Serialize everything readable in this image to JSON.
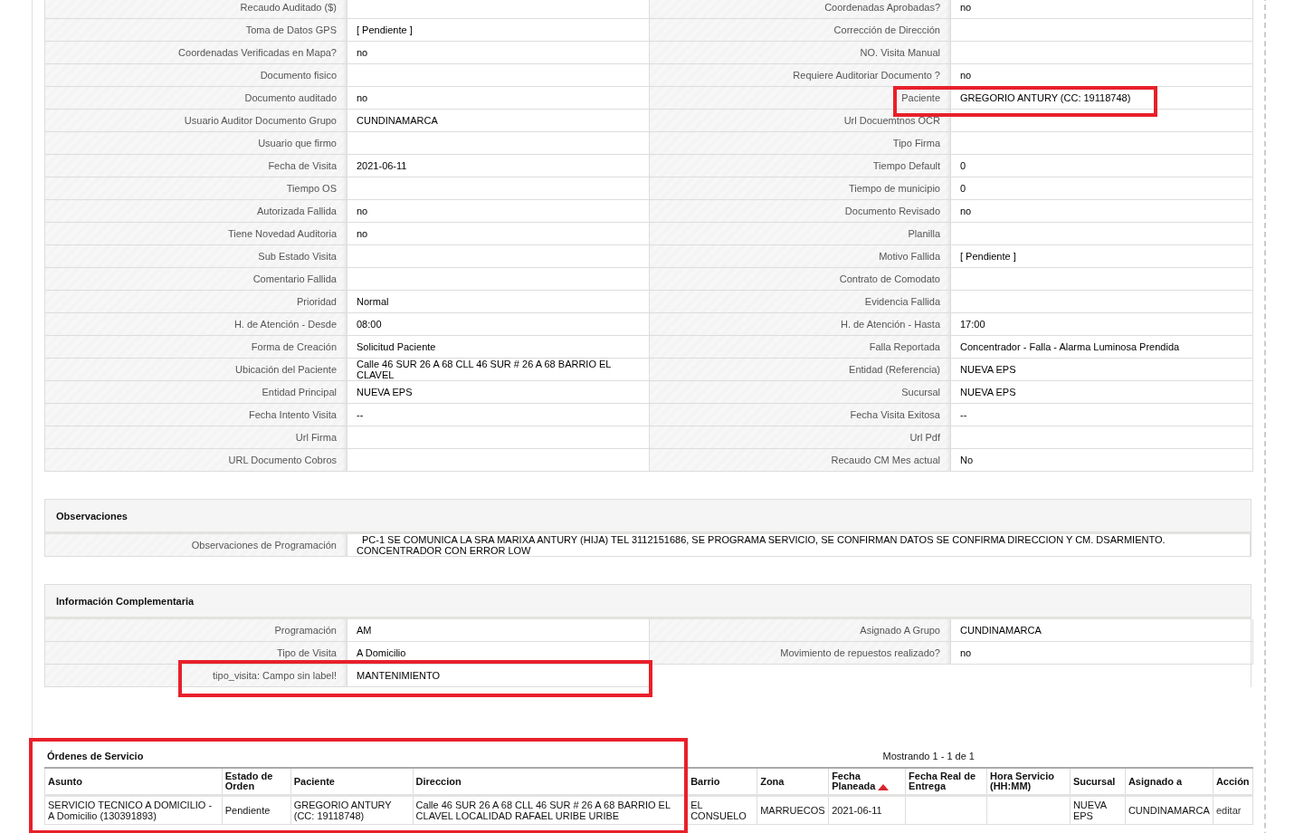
{
  "details": {
    "rows": [
      {
        "left": {
          "label": "Recaudo Auditado ($)"
        },
        "right": {
          "label": "Coordenadas Aprobadas?",
          "value": "no",
          "highlighted": false
        }
      },
      {
        "left": {
          "label": "Toma de Datos GPS",
          "value": "[ Pendiente ]"
        },
        "right": {
          "label": "Corrección de Dirección",
          "highlighted": false
        }
      },
      {
        "left": {
          "label": "Coordenadas Verificadas en Mapa?",
          "value": "no"
        },
        "right": {
          "label": "NO. Visita Manual",
          "highlighted": false
        }
      },
      {
        "left": {
          "label": "Documento fisico"
        },
        "right": {
          "label": "Requiere Auditoriar Documento ?",
          "value": "no",
          "highlighted": false
        }
      },
      {
        "left": {
          "label": "Documento auditado",
          "value": "no"
        },
        "right": {
          "label": "Paciente",
          "value": "GREGORIO ANTURY (CC: 19118748)",
          "highlighted": true
        }
      },
      {
        "left": {
          "label": "Usuario Auditor Documento Grupo",
          "value": "CUNDINAMARCA"
        },
        "right": {
          "label": "Url Docuemtnos OCR",
          "highlighted": false
        }
      },
      {
        "left": {
          "label": "Usuario que firmo"
        },
        "right": {
          "label": "Tipo Firma",
          "highlighted": false
        }
      },
      {
        "left": {
          "label": "Fecha de Visita",
          "value": "2021-06-11"
        },
        "right": {
          "label": "Tiempo Default",
          "value": "0",
          "highlighted": false
        }
      },
      {
        "left": {
          "label": "Tiempo OS"
        },
        "right": {
          "label": "Tiempo de municipio",
          "value": "0",
          "highlighted": false
        }
      },
      {
        "left": {
          "label": "Autorizada Fallida",
          "value": "no"
        },
        "right": {
          "label": "Documento Revisado",
          "value": "no",
          "highlighted": false
        }
      },
      {
        "left": {
          "label": "Tiene Novedad Auditoria",
          "value": "no"
        },
        "right": {
          "label": "Planilla",
          "highlighted": false
        }
      },
      {
        "left": {
          "label": "Sub Estado Visita"
        },
        "right": {
          "label": "Motivo Fallida",
          "value": "[ Pendiente ]",
          "highlighted": false
        }
      },
      {
        "left": {
          "label": "Comentario Fallida"
        },
        "right": {
          "label": "Contrato de Comodato",
          "highlighted": false
        }
      },
      {
        "left": {
          "label": "Prioridad",
          "value": "Normal"
        },
        "right": {
          "label": "Evidencia Fallida",
          "highlighted": false
        }
      },
      {
        "left": {
          "label": "H. de Atención - Desde",
          "value": "08:00"
        },
        "right": {
          "label": "H. de Atención - Hasta",
          "value": "17:00",
          "highlighted": false
        }
      },
      {
        "left": {
          "label": "Forma de Creación",
          "value": "Solicitud Paciente"
        },
        "right": {
          "label": "Falla Reportada",
          "value": "Concentrador - Falla - Alarma Luminosa Prendida",
          "highlighted": false
        }
      },
      {
        "left": {
          "label": "Ubicación del Paciente",
          "value": "Calle 46 SUR 26 A 68 CLL 46 SUR # 26 A 68 BARRIO EL CLAVEL"
        },
        "right": {
          "label": "Entidad (Referencia)",
          "value": "NUEVA EPS",
          "highlighted": false
        }
      },
      {
        "left": {
          "label": "Entidad Principal",
          "value": "NUEVA EPS"
        },
        "right": {
          "label": "Sucursal",
          "value": "NUEVA EPS",
          "highlighted": false
        }
      },
      {
        "left": {
          "label": "Fecha Intento Visita",
          "value": "--"
        },
        "right": {
          "label": "Fecha Visita Exitosa",
          "value": "--",
          "highlighted": false
        }
      },
      {
        "left": {
          "label": "Url Firma"
        },
        "right": {
          "label": "Url Pdf",
          "highlighted": false
        }
      },
      {
        "left": {
          "label": "URL Documento Cobros"
        },
        "right": {
          "label": "Recaudo CM Mes actual",
          "value": "No",
          "highlighted": false
        }
      }
    ]
  },
  "observaciones": {
    "title": "Observaciones",
    "label": "Observaciones de Programación",
    "value": "PC-1 SE COMUNICA LA SRA MARIXA ANTURY (HIJA) TEL 3112151686, SE PROGRAMA SERVICIO, SE CONFIRMAN DATOS SE CONFIRMA DIRECCION Y CM. DSARMIENTO. CONCENTRADOR CON ERROR LOW"
  },
  "complementaria": {
    "title": "Información Complementaria",
    "rows": [
      {
        "left": {
          "label": "Programación",
          "value": "AM",
          "highlighted": false
        },
        "right": {
          "label": "Asignado A Grupo",
          "value": "CUNDINAMARCA"
        }
      },
      {
        "left": {
          "label": "Tipo de Visita",
          "value": "A Domicilio",
          "highlighted": false
        },
        "right": {
          "label": "Movimiento de repuestos realizado?",
          "value": "no"
        }
      },
      {
        "left": {
          "label": "tipo_visita: Campo sin label!",
          "value": "MANTENIMIENTO",
          "highlighted": true
        }
      }
    ]
  },
  "orders": {
    "title": "Órdenes de Servicio",
    "highlighted": true,
    "pager": "Mostrando 1 - 1 de 1",
    "columns": [
      {
        "label": "Asunto",
        "sorted": false
      },
      {
        "label": "Estado de Orden",
        "sorted": false
      },
      {
        "label": "Paciente",
        "sorted": false
      },
      {
        "label": "Direccion",
        "sorted": false
      },
      {
        "label": "Barrio",
        "sorted": false
      },
      {
        "label": "Zona",
        "sorted": false
      },
      {
        "label": "Fecha Planeada",
        "sorted": true
      },
      {
        "label": "Fecha Real de Entrega",
        "sorted": false
      },
      {
        "label": "Hora Servicio (HH:MM)",
        "sorted": false
      },
      {
        "label": "Sucursal",
        "sorted": false
      },
      {
        "label": "Asignado a",
        "sorted": false
      },
      {
        "label": "Acción",
        "sorted": false
      }
    ],
    "rows": [
      {
        "cells": [
          "SERVICIO TECNICO A DOMICILIO - A Domicilio (130391893)",
          "Pendiente",
          "GREGORIO ANTURY (CC: 19118748)",
          "Calle 46 SUR 26 A 68 CLL 46 SUR # 26 A 68 BARRIO EL CLAVEL LOCALIDAD RAFAEL URIBE URIBE",
          "EL CONSUELO",
          "MARRUECOS",
          "2021-06-11",
          null,
          null,
          "NUEVA EPS",
          "CUNDINAMARCA"
        ],
        "action": "editar"
      }
    ]
  }
}
